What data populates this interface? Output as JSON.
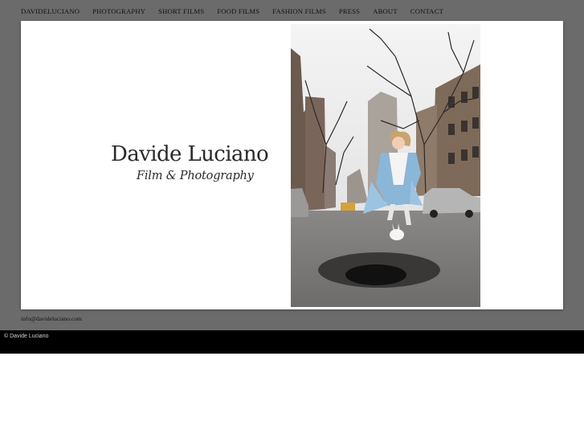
{
  "nav": {
    "items": [
      {
        "label": "DAVIDELUCIANO"
      },
      {
        "label": "PHOTOGRAPHY"
      },
      {
        "label": "SHORT FILMS"
      },
      {
        "label": "FOOD FILMS"
      },
      {
        "label": "FASHION FILMS"
      },
      {
        "label": "PRESS"
      },
      {
        "label": "ABOUT"
      },
      {
        "label": "CONTACT"
      }
    ]
  },
  "hero": {
    "title": "Davide Luciano",
    "subtitle": "Film & Photography"
  },
  "contact": {
    "email": "info@davideluciano.com"
  },
  "footer": {
    "copyright": "© Davide Luciano"
  },
  "colors": {
    "page_background": "#6b6b6b",
    "card": "#ffffff",
    "footer_bar": "#000000"
  }
}
